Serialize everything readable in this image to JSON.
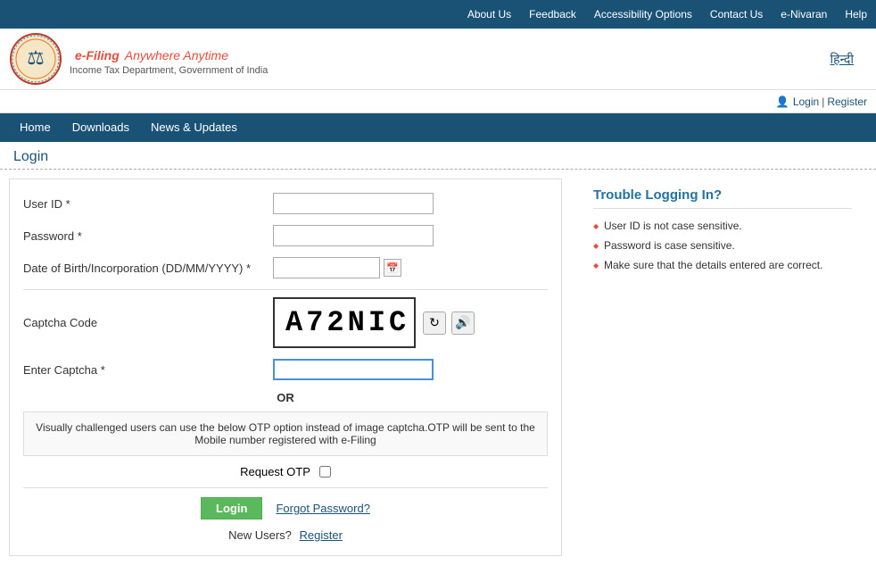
{
  "topbar": {
    "items": [
      {
        "id": "about-us",
        "label": "About Us",
        "active": false
      },
      {
        "id": "feedback",
        "label": "Feedback",
        "active": false
      },
      {
        "id": "accessibility",
        "label": "Accessibility Options",
        "active": false
      },
      {
        "id": "contact-us",
        "label": "Contact Us",
        "active": false
      },
      {
        "id": "e-nivaran",
        "label": "e-Nivaran",
        "active": false
      },
      {
        "id": "help",
        "label": "Help",
        "active": false
      }
    ]
  },
  "header": {
    "logo_title": "e-Filing",
    "logo_tagline": "Anywhere Anytime",
    "logo_subtitle": "Income Tax Department, Government of India",
    "hindi_label": "हिन्दी"
  },
  "login_register": {
    "login_label": "Login",
    "register_label": "Register",
    "user_icon": "👤"
  },
  "navbar": {
    "items": [
      {
        "id": "home",
        "label": "Home"
      },
      {
        "id": "downloads",
        "label": "Downloads"
      },
      {
        "id": "news-updates",
        "label": "News & Updates"
      }
    ]
  },
  "page": {
    "title": "Login"
  },
  "form": {
    "user_id_label": "User ID *",
    "user_id_placeholder": "",
    "password_label": "Password *",
    "password_placeholder": "",
    "dob_label": "Date of Birth/Incorporation (DD/MM/YYYY) *",
    "dob_placeholder": "",
    "captcha_label": "Captcha Code",
    "captcha_value": "A72NIC",
    "enter_captcha_label": "Enter Captcha *",
    "enter_captcha_placeholder": "",
    "or_label": "OR",
    "otp_info": "Visually challenged users can use the below OTP option instead of image captcha.OTP will be sent to the Mobile number registered with e-Filing",
    "request_otp_label": "Request OTP",
    "login_button": "Login",
    "forgot_password": "Forgot Password?",
    "new_users_label": "New Users?",
    "register_link": "Register"
  },
  "trouble": {
    "title": "Trouble Logging In?",
    "tips": [
      "User ID is not case sensitive.",
      "Password is case sensitive.",
      "Make sure that the details entered are correct."
    ]
  }
}
